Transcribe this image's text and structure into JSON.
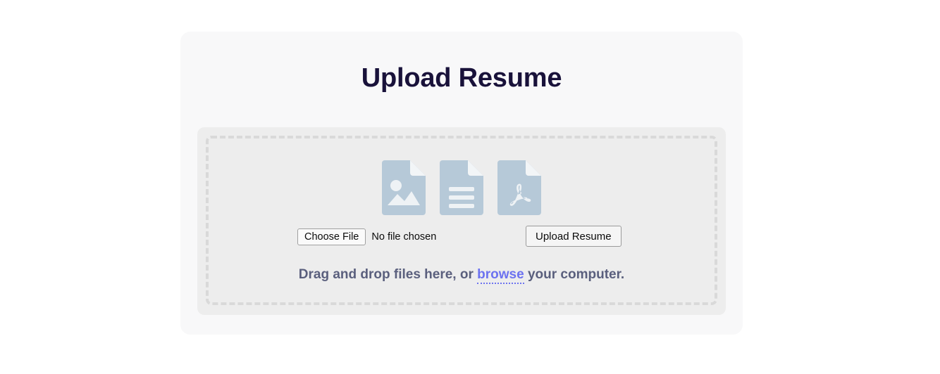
{
  "card": {
    "title": "Upload Resume"
  },
  "dropzone": {
    "icons": [
      {
        "name": "image-file-icon",
        "label": "image file"
      },
      {
        "name": "document-file-icon",
        "label": "text document file"
      },
      {
        "name": "pdf-file-icon",
        "label": "pdf file"
      }
    ],
    "file_input": {
      "button_label": "Choose File",
      "status_text": "No file chosen"
    },
    "upload_button_label": "Upload Resume",
    "hint": {
      "prefix": "Drag and drop files here, or ",
      "link_label": "browse",
      "suffix": " your computer."
    }
  },
  "colors": {
    "page_background": "#ffffff",
    "card_background": "#f8f8f9",
    "dropzone_background": "#ededed",
    "dashed_border": "#d9d9d9",
    "title_text": "#19123a",
    "hint_text": "#5a5f7d",
    "link_accent": "#6c72f0",
    "file_icon": "#b6c9d8",
    "file_icon_detail": "#eef2f5"
  }
}
